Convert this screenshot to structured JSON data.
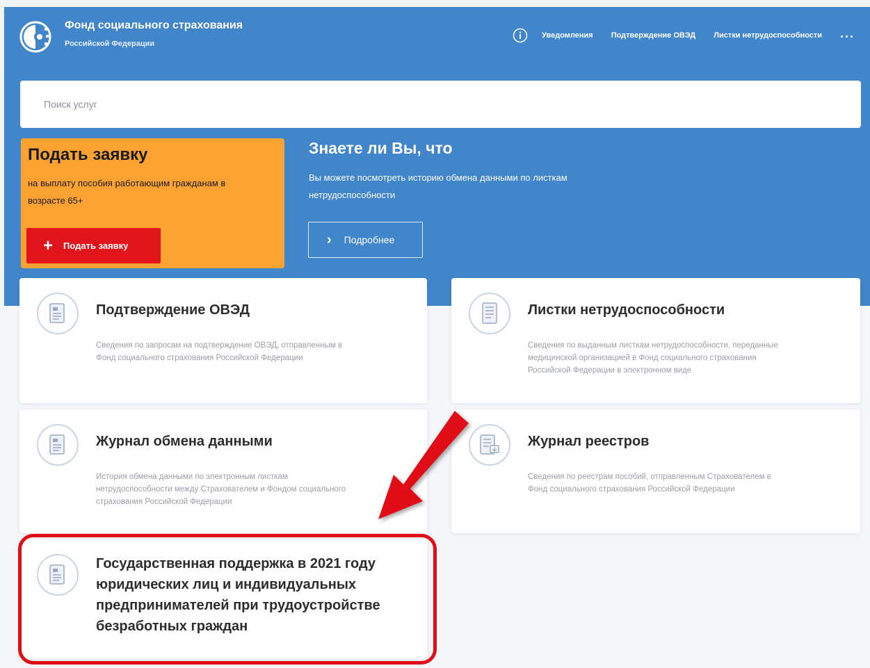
{
  "header": {
    "brand_title": "Фонд социального страхования",
    "brand_subtitle": "Российской Федерации",
    "logo_icon": "fss-logo-icon",
    "nav": [
      {
        "label": "Уведомления"
      },
      {
        "label": "Подтверждение ОВЭД"
      },
      {
        "label": "Листки нетрудоспособности"
      }
    ],
    "more_label": "...",
    "info_icon": "info-circle-icon"
  },
  "search": {
    "placeholder": "Поиск услуг",
    "value": ""
  },
  "promo": {
    "title": "Подать заявку",
    "text": "на выплату пособия работающим гражданам в возрасте 65+",
    "button_label": "Подать заявку",
    "button_icon": "plus-icon",
    "bg_color": "#fba233",
    "button_color": "#e1161c"
  },
  "did_you_know": {
    "title": "Знаете ли Вы, что",
    "text": "Вы можете посмотреть историю обмена данными по листкам нетрудоспособности",
    "button_label": "Подробнее",
    "button_icon": "chevron-right-icon"
  },
  "cards": [
    {
      "title": "Подтверждение ОВЭД",
      "description": "Сведения по запросам на подтверждение ОВЭД, отправленным в Фонд социального страхования Российской Федерации",
      "icon": "document-icon"
    },
    {
      "title": "Листки нетрудоспособности",
      "description": "Сведения по выданным листкам нетрудоспособности, переданные медицинской организацией в Фонд социального страхования Российской Федерации в электронном виде",
      "icon": "sick-leave-icon"
    },
    {
      "title": "Журнал обмена данными",
      "description": "История обмена данными по электронным листкам нетрудоспособности между Страхователем и Фондом социального страхования Российской Федерации",
      "icon": "document-icon"
    },
    {
      "title": "Журнал реестров",
      "description": "Сведения по реестрам пособий, отправленным Страхователем в Фонд социального страхования Российской Федерации",
      "icon": "registry-icon"
    },
    {
      "title": "Государственная поддержка в 2021 году юридических лиц и индивидуальных предпринимателей при трудоустройстве безработных граждан",
      "description": "",
      "icon": "document-icon"
    }
  ],
  "colors": {
    "header_blue": "#4185cb",
    "highlight_red": "#e00f16",
    "arrow_red": "#e00f16"
  }
}
